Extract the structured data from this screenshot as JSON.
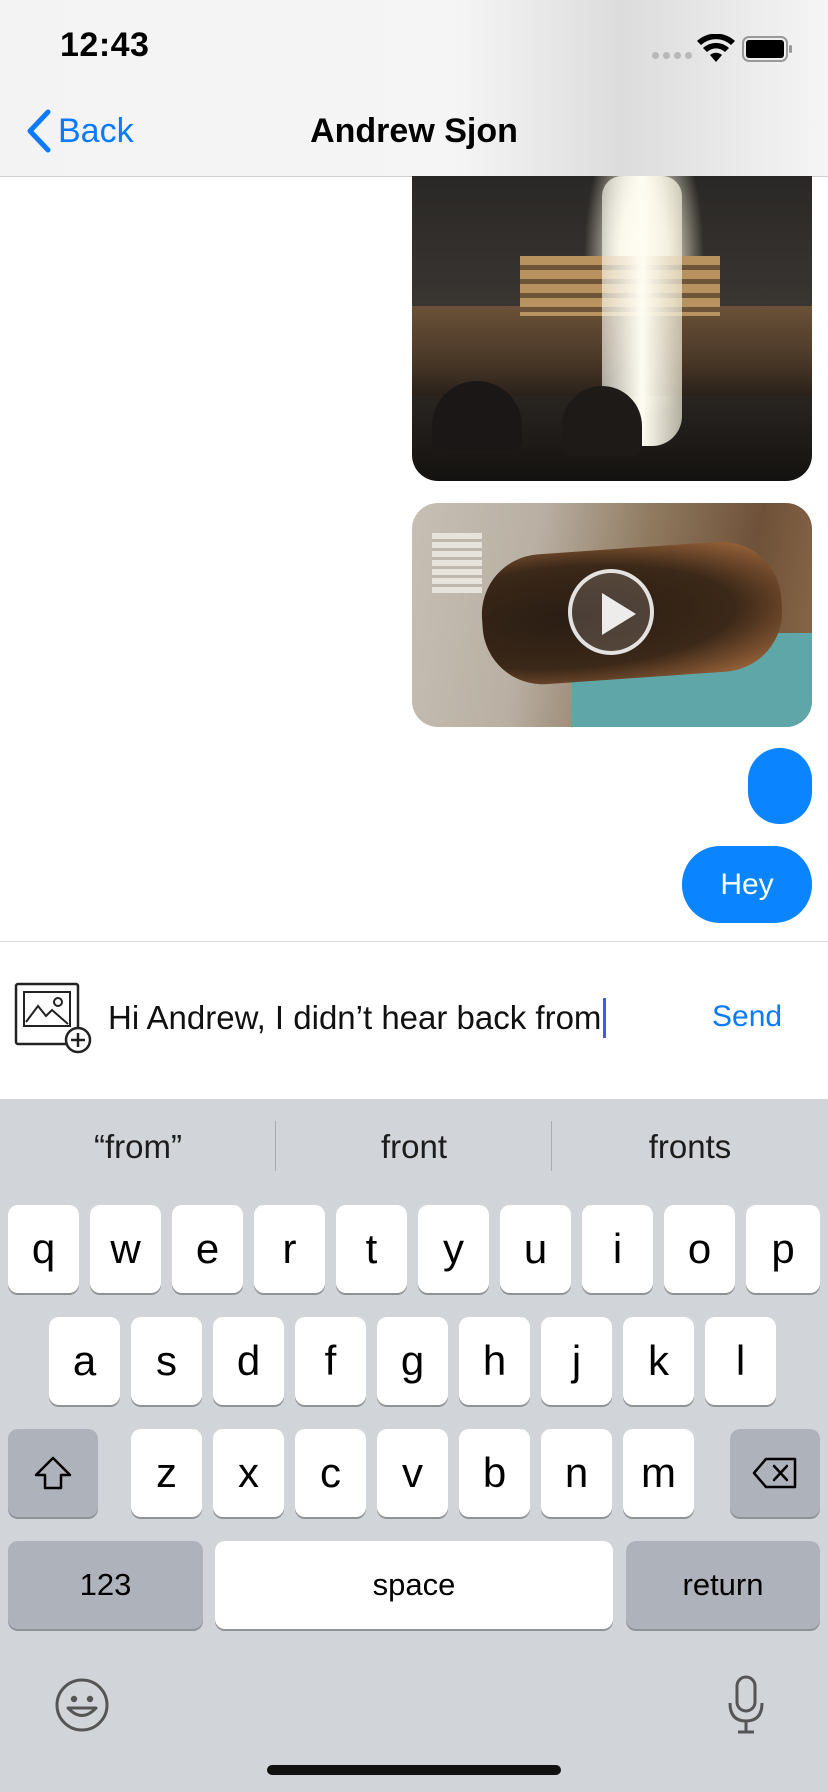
{
  "status_bar": {
    "time": "12:43"
  },
  "nav": {
    "back_label": "Back",
    "title": "Andrew Sjon"
  },
  "messages": [
    {
      "type": "image",
      "description_icon": "photo"
    },
    {
      "type": "video",
      "description_icon": "play-icon"
    },
    {
      "type": "text",
      "text": ""
    },
    {
      "type": "text",
      "text": "Hey"
    }
  ],
  "composer": {
    "text": "Hi Andrew, I didn’t hear back from",
    "send_label": "Send"
  },
  "keyboard": {
    "suggestions": [
      "“from”",
      "front",
      "fronts"
    ],
    "row1": [
      "q",
      "w",
      "e",
      "r",
      "t",
      "y",
      "u",
      "i",
      "o",
      "p"
    ],
    "row2": [
      "a",
      "s",
      "d",
      "f",
      "g",
      "h",
      "j",
      "k",
      "l"
    ],
    "row3": [
      "z",
      "x",
      "c",
      "v",
      "b",
      "n",
      "m"
    ],
    "numbers_label": "123",
    "space_label": "space",
    "return_label": "return"
  },
  "colors": {
    "accent": "#0a84ff",
    "link": "#0a7aff",
    "keyboard_bg": "#d1d4d9"
  }
}
